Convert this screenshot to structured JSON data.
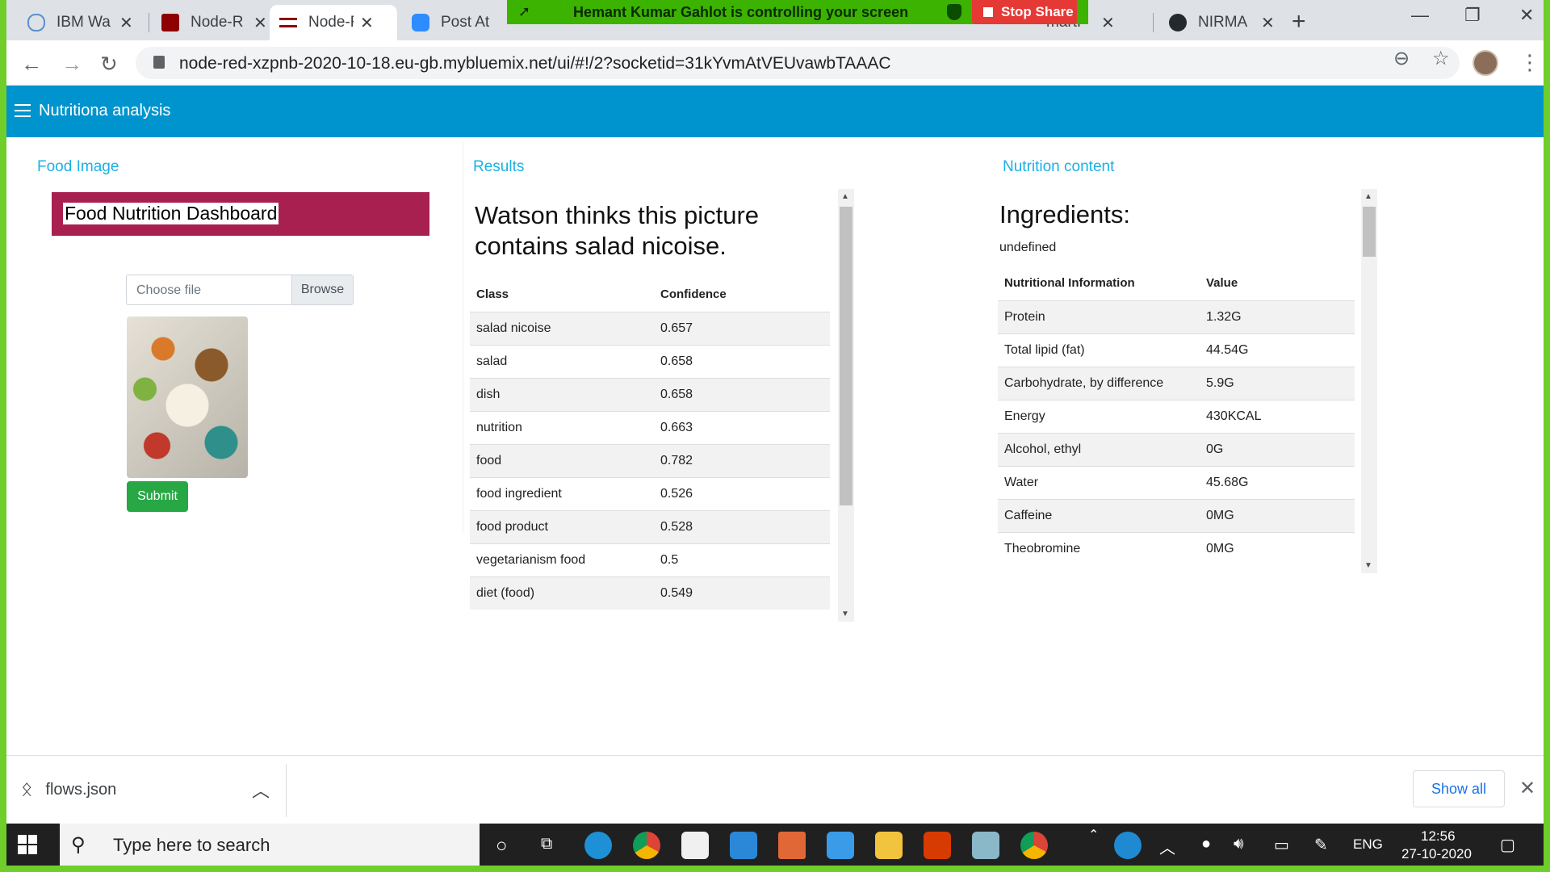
{
  "browser": {
    "tabs": [
      {
        "label": "IBM Wa",
        "icon": "cloud-icon"
      },
      {
        "label": "Node-R",
        "icon": "node-red-icon"
      },
      {
        "label": "Node-R",
        "icon": "node-red-icon"
      },
      {
        "label": "Post At",
        "icon": "zoom-icon"
      },
      {
        "label": "martP",
        "icon": "tab-icon"
      },
      {
        "label": "NIRMA",
        "icon": "github-icon"
      }
    ],
    "new_tab": "+",
    "url": "node-red-xzpnb-2020-10-18.eu-gb.mybluemix.net/ui/#!/2?socketid=31kYvmAtVEUvawbTAAAC",
    "minimize": "—",
    "maximize": "❐",
    "close": "✕"
  },
  "share_banner": {
    "text": "Hemant Kumar Gahlot is controlling your screen",
    "stop_label": "Stop Share"
  },
  "app": {
    "title": "Nutritiona analysis"
  },
  "food_image": {
    "group_title": "Food Image",
    "banner": "Food Nutrition Dashboard",
    "file_placeholder": "Choose file",
    "browse_label": "Browse",
    "submit_label": "Submit"
  },
  "results": {
    "group_title": "Results",
    "heading": "Watson thinks this picture contains salad nicoise.",
    "columns": [
      "Class",
      "Confidence"
    ],
    "rows": [
      [
        "salad nicoise",
        "0.657"
      ],
      [
        "salad",
        "0.658"
      ],
      [
        "dish",
        "0.658"
      ],
      [
        "nutrition",
        "0.663"
      ],
      [
        "food",
        "0.782"
      ],
      [
        "food ingredient",
        "0.526"
      ],
      [
        "food product",
        "0.528"
      ],
      [
        "vegetarianism food",
        "0.5"
      ],
      [
        "diet (food)",
        "0.549"
      ]
    ]
  },
  "nutrition": {
    "group_title": "Nutrition content",
    "heading": "Ingredients:",
    "ingredients_value": "undefined",
    "columns": [
      "Nutritional Information",
      "Value"
    ],
    "rows": [
      [
        "Protein",
        "1.32G"
      ],
      [
        "Total lipid (fat)",
        "44.54G"
      ],
      [
        "Carbohydrate, by difference",
        "5.9G"
      ],
      [
        "Energy",
        "430KCAL"
      ],
      [
        "Alcohol, ethyl",
        "0G"
      ],
      [
        "Water",
        "45.68G"
      ],
      [
        "Caffeine",
        "0MG"
      ],
      [
        "Theobromine",
        "0MG"
      ]
    ]
  },
  "downloads": {
    "file": "flows.json",
    "show_all": "Show all"
  },
  "taskbar": {
    "search_placeholder": "Type here to search",
    "lang": "ENG",
    "time": "12:56",
    "date": "27-10-2020"
  },
  "colors": {
    "header_blue": "#0094ce",
    "group_title": "#1bb0e6",
    "banner_magenta": "#a8204f",
    "submit_green": "#28a745",
    "share_green": "#3bb300",
    "stop_red": "#e53935"
  }
}
